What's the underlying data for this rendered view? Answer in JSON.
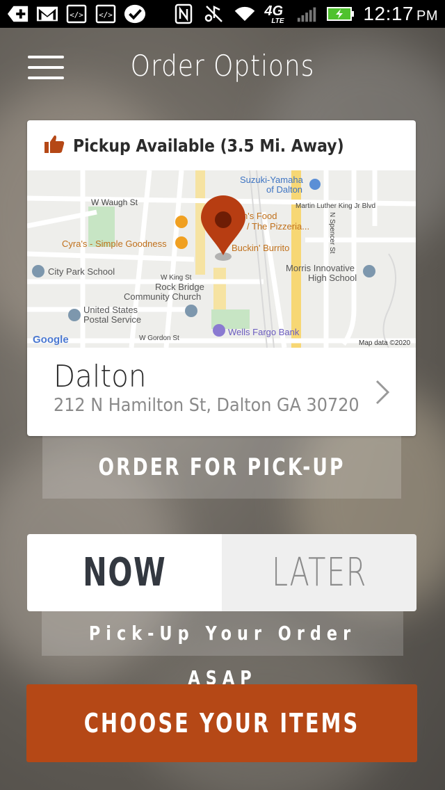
{
  "status_bar": {
    "time": "12:17",
    "ampm": "PM",
    "network": "4G",
    "network_sub": "LTE",
    "icons": [
      "add-icon",
      "gmail-icon",
      "code-icon",
      "code-icon",
      "check-icon",
      "nfc-icon",
      "mute-icon",
      "wifi-icon",
      "signal-icon",
      "battery-charging-icon"
    ]
  },
  "header": {
    "title": "Order Options",
    "menu_icon": "hamburger-menu-icon"
  },
  "location_card": {
    "availability": "Pickup Available (3.5 Mi. Away)",
    "availability_icon": "thumbs-up-icon",
    "name": "Dalton",
    "address": "212 N Hamilton St, Dalton GA 30720",
    "map": {
      "labels": {
        "suzuki": "Suzuki-Yamaha",
        "suzuki2": "of Dalton",
        "w_waugh": "W Waugh St",
        "mlk": "Martin Luther King Jr Blvd",
        "ns_food": "n's Food",
        "pizzeria": "/ The Pizzeria...",
        "cyras": "Cyra's - Simple Goodness",
        "buckin": "Buckin' Burrito",
        "n_spencer": "N Spencer St",
        "city_park": "City Park School",
        "w_king": "W King St",
        "morris1": "Morris Innovative",
        "morris2": "High School",
        "rock1": "Rock Bridge",
        "rock2": "Community Church",
        "usps1": "United States",
        "usps2": "Postal Service",
        "wells": "Wells Fargo Bank",
        "w_gordon": "W Gordon St",
        "google": "Google",
        "mapdata": "Map data ©2020"
      }
    }
  },
  "order_pickup_label": "ORDER FOR PICK-UP",
  "timing": {
    "now_label": "NOW",
    "later_label": "LATER",
    "selected": "NOW",
    "subtitle": "Pick-Up Your Order ASAP"
  },
  "cta_label": "CHOOSE YOUR ITEMS",
  "colors": {
    "accent": "#b54816",
    "pin": "#b73d12"
  }
}
